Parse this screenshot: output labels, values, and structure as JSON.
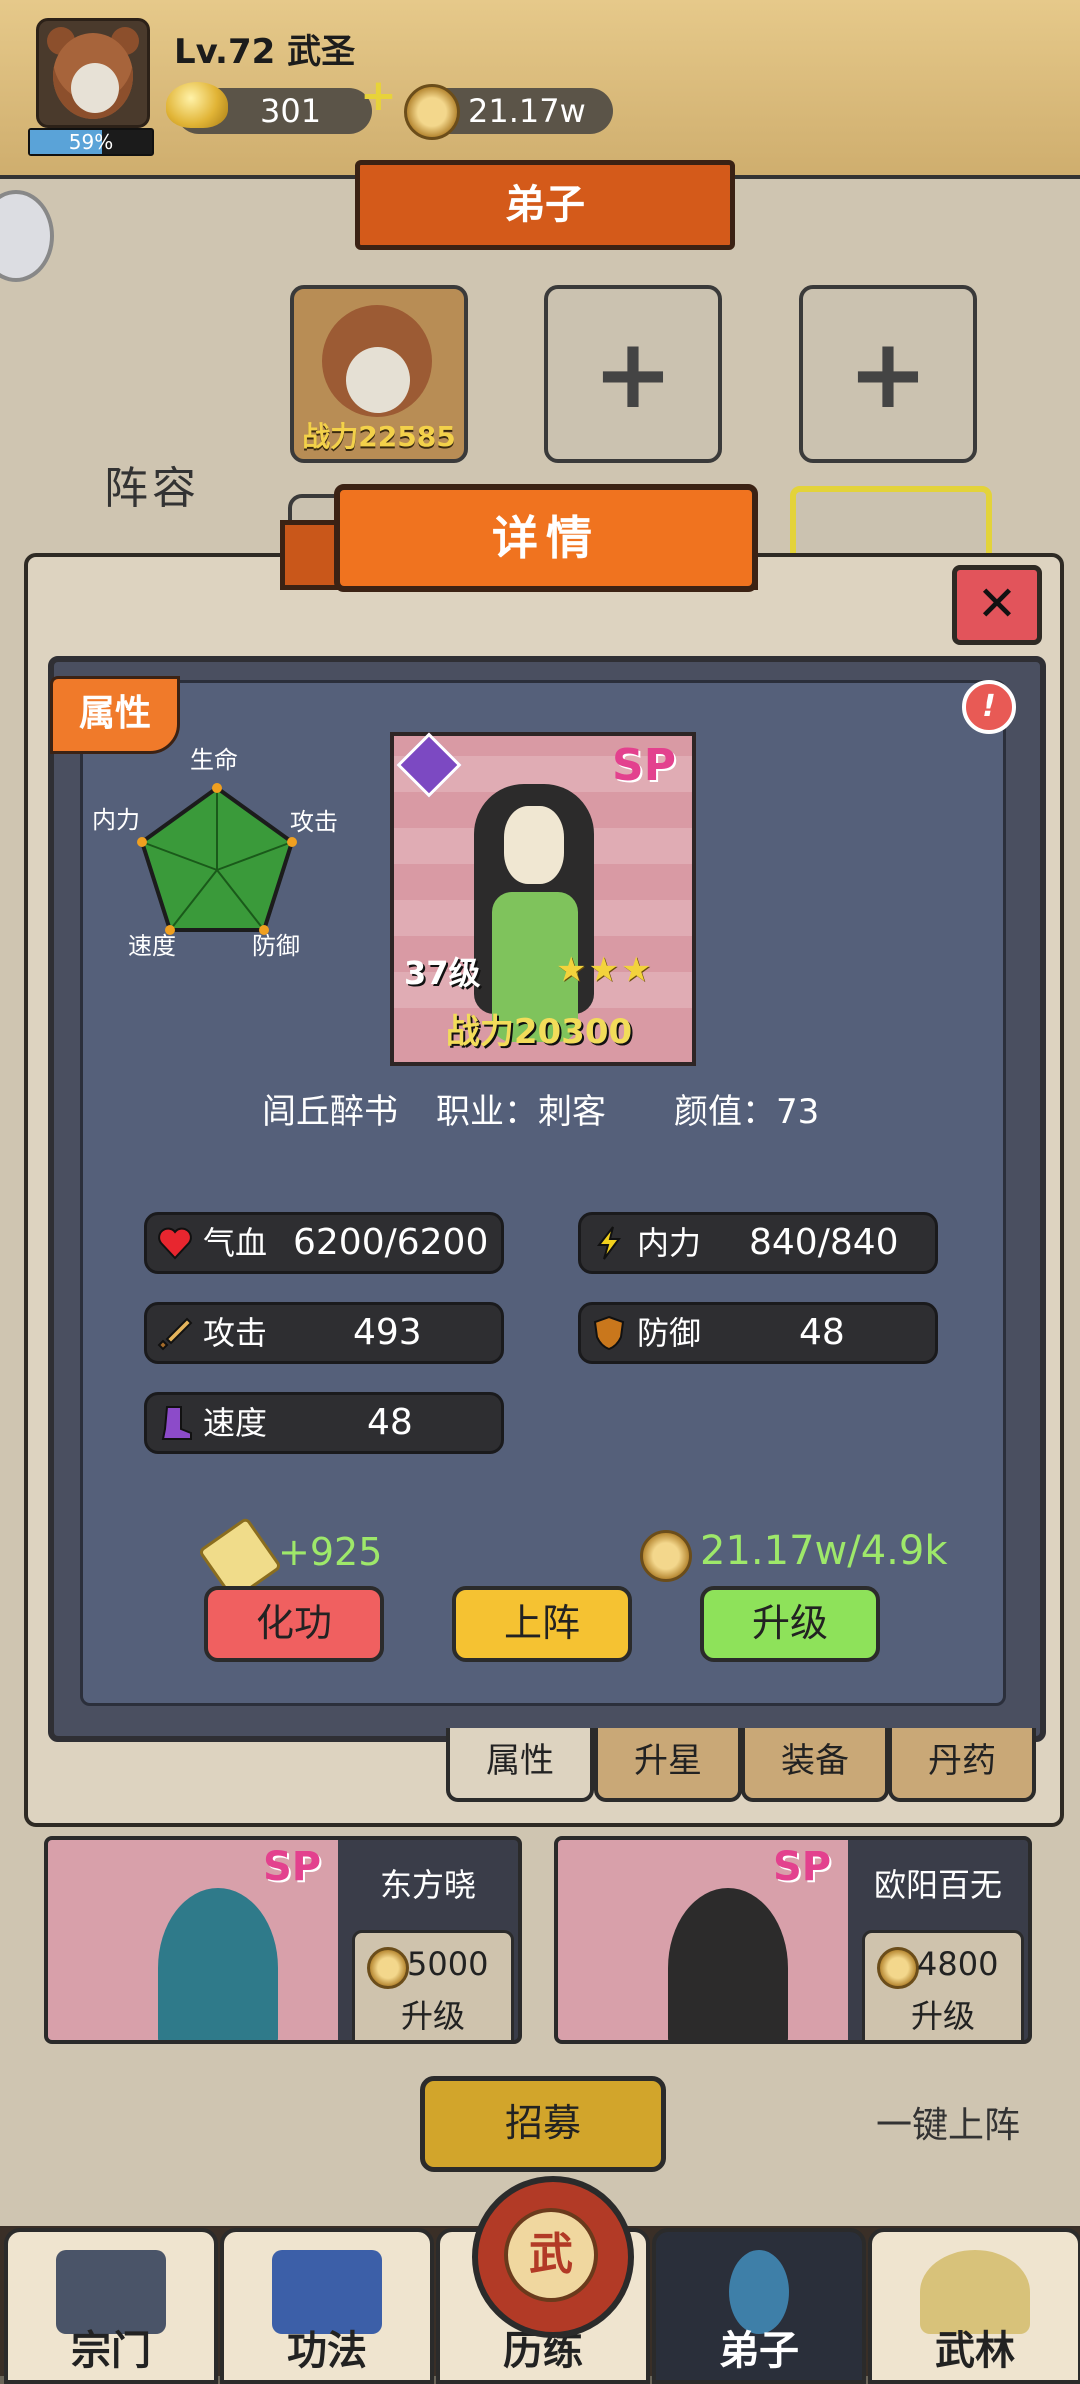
{
  "player": {
    "level_title": "Lv.72 武圣",
    "xp_percent": "59%",
    "xp_fraction": 0.59,
    "gold": "301",
    "coins": "21.17w"
  },
  "page": {
    "title": "弟子",
    "lineup_label": "阵容",
    "slot1_power": "战力22585"
  },
  "modal": {
    "title": "详情",
    "attributes_tag": "属性",
    "radar_labels": {
      "top": "生命",
      "left": "内力",
      "right": "攻击",
      "bottom_left": "速度",
      "bottom_right": "防御"
    },
    "card": {
      "rarity": "SP",
      "level": "37级",
      "stars": "★★★",
      "power": "战力20300"
    },
    "info": {
      "name": "闾丘醉书",
      "profession": "职业：刺客",
      "appearance": "颜值：73"
    },
    "stats": {
      "hp": {
        "label": "气血",
        "value": "6200/6200"
      },
      "mp": {
        "label": "内力",
        "value": "840/840"
      },
      "atk": {
        "label": "攻击",
        "value": "493"
      },
      "def": {
        "label": "防御",
        "value": "48"
      },
      "spd": {
        "label": "速度",
        "value": "48"
      }
    },
    "exp_gain": "+925",
    "upgrade_cost": "21.17w/4.9k",
    "buttons": {
      "refine": "化功",
      "deploy": "上阵",
      "upgrade": "升级"
    },
    "tabs": {
      "attributes": "属性",
      "stars": "升星",
      "equipment": "装备",
      "pills": "丹药"
    }
  },
  "roster": [
    {
      "rarity": "SP",
      "name": "东方晓",
      "price": "5000",
      "action": "升级"
    },
    {
      "rarity": "SP",
      "name": "欧阳百无",
      "price": "4800",
      "action": "升级"
    }
  ],
  "actions": {
    "recruit": "招募",
    "one_key_deploy": "一键上阵"
  },
  "nav": {
    "sect": "宗门",
    "skills": "功法",
    "training": "历练",
    "disciples": "弟子",
    "martial": "武林",
    "drum_char": "武"
  },
  "colors": {
    "accent_orange": "#f0731f",
    "panel": "#4a4f60",
    "green_text": "#9ee86a",
    "gold_text": "#f2dc5a",
    "sp_pink": "#e3418e"
  }
}
